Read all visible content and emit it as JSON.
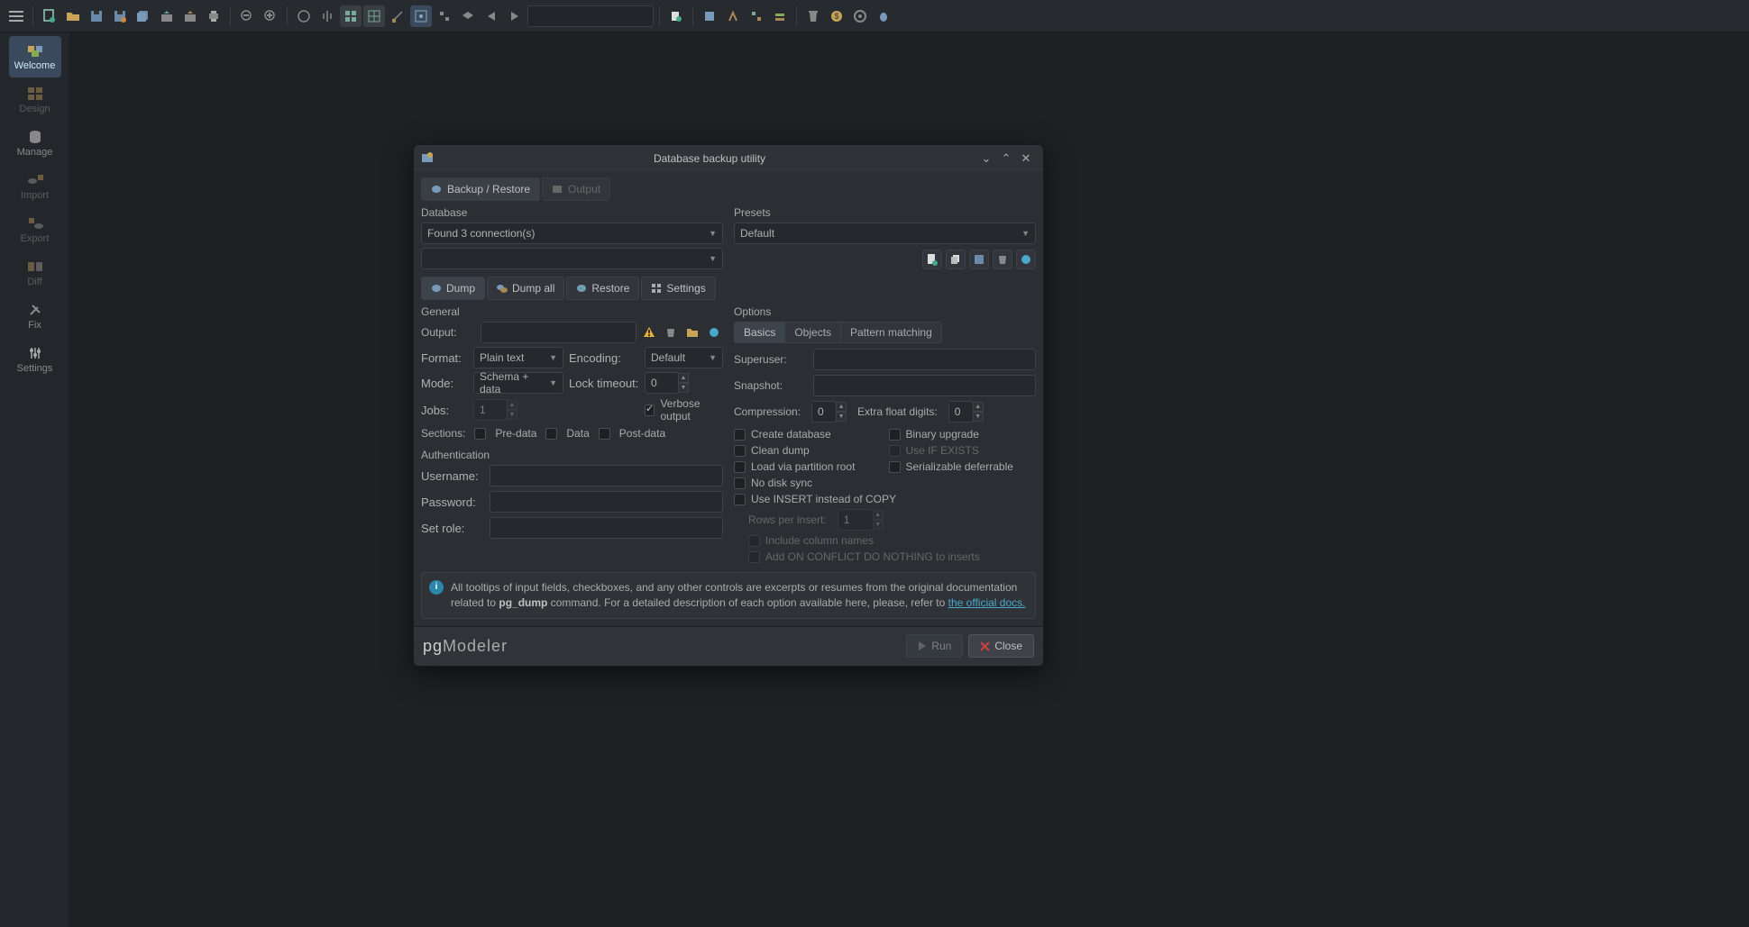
{
  "sidebar": {
    "items": [
      {
        "label": "Welcome",
        "icon": "welcome-icon"
      },
      {
        "label": "Design",
        "icon": "design-icon"
      },
      {
        "label": "Manage",
        "icon": "manage-icon"
      },
      {
        "label": "Import",
        "icon": "import-icon"
      },
      {
        "label": "Export",
        "icon": "export-icon"
      },
      {
        "label": "Diff",
        "icon": "diff-icon"
      },
      {
        "label": "Fix",
        "icon": "fix-icon"
      },
      {
        "label": "Settings",
        "icon": "settings-icon"
      }
    ]
  },
  "dialog": {
    "title": "Database backup utility",
    "tabs": {
      "backup_restore": "Backup / Restore",
      "output": "Output"
    },
    "database_label": "Database",
    "presets_label": "Presets",
    "connections_text": "Found 3 connection(s)",
    "preset_value": "Default",
    "mode_tabs": {
      "dump": "Dump",
      "dump_all": "Dump all",
      "restore": "Restore",
      "settings": "Settings"
    },
    "general_label": "General",
    "options_label": "Options",
    "general": {
      "output_lbl": "Output:",
      "format_lbl": "Format:",
      "format_val": "Plain text",
      "encoding_lbl": "Encoding:",
      "encoding_val": "Default",
      "mode_lbl": "Mode:",
      "mode_val": "Schema + data",
      "lock_lbl": "Lock timeout:",
      "lock_val": "0",
      "jobs_lbl": "Jobs:",
      "jobs_val": "1",
      "verbose_lbl": "Verbose output",
      "sections_lbl": "Sections:",
      "predata": "Pre-data",
      "data": "Data",
      "postdata": "Post-data"
    },
    "auth_label": "Authentication",
    "auth": {
      "user_lbl": "Username:",
      "pass_lbl": "Password:",
      "role_lbl": "Set role:"
    },
    "opt_tabs": {
      "basics": "Basics",
      "objects": "Objects",
      "pattern": "Pattern matching"
    },
    "options": {
      "superuser_lbl": "Superuser:",
      "snapshot_lbl": "Snapshot:",
      "compression_lbl": "Compression:",
      "compression_val": "0",
      "extra_float_lbl": "Extra float digits:",
      "extra_float_val": "0",
      "create_db": "Create database",
      "binary_upgrade": "Binary upgrade",
      "clean_dump": "Clean dump",
      "use_if_exists": "Use IF EXISTS",
      "load_partition": "Load via partition root",
      "serializable": "Serializable deferrable",
      "no_disk_sync": "No disk sync",
      "use_insert": "Use INSERT instead of COPY",
      "rows_per_insert_lbl": "Rows per insert:",
      "rows_per_insert_val": "1",
      "include_col_names": "Include column names",
      "add_on_conflict": "Add ON CONFLICT DO NOTHING to inserts"
    },
    "info_pre": "All tooltips of input fields, checkboxes, and any other controls are excerpts or resumes from the original documentation related to ",
    "info_cmd": "pg_dump",
    "info_mid": " command. For a detailed description of each option available here, please, refer to ",
    "info_link": "the official docs.",
    "logo_pg": "pg",
    "logo_modeler": "Modeler",
    "run_btn": "Run",
    "close_btn": "Close"
  }
}
